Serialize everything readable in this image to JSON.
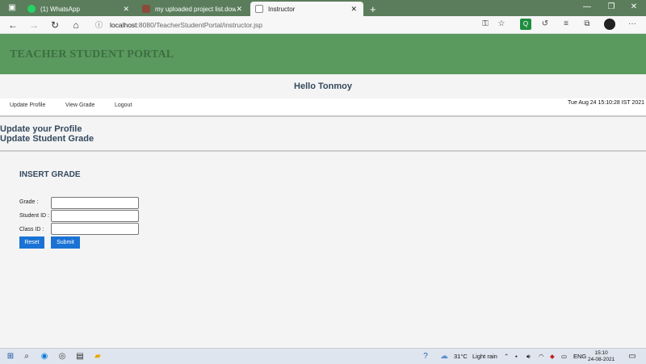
{
  "browser": {
    "tabs": [
      {
        "label": "(1) WhatsApp"
      },
      {
        "label": "my uploaded project list.downlo"
      },
      {
        "label": "Instructor"
      }
    ],
    "new_tab_glyph": "+",
    "close_glyph": "✕",
    "window_controls": {
      "minimize": "—",
      "restore": "❐",
      "close": "✕"
    },
    "url_host": "localhost",
    "url_rest": ":8080/TeacherStudentPortal/instructor.jsp",
    "nav": {
      "back": "←",
      "forward": "→",
      "reload": "↻",
      "home": "⌂"
    },
    "more_glyph": "···"
  },
  "page": {
    "banner_title": "TEACHER STUDENT PORTAL",
    "greeting": "Hello Tonmoy",
    "menu": {
      "update_profile": "Update Profile",
      "view_grade": "View Grade",
      "logout": "Logout"
    },
    "datetime": "Tue Aug 24 15:10:28 IST 2021",
    "links": {
      "update_profile": "Update your Profile",
      "update_grade": "Update Student Grade"
    },
    "form": {
      "heading": "INSERT GRADE",
      "grade_label": "Grade :",
      "student_id_label": "Student ID :",
      "class_id_label": "Class ID :",
      "grade_value": "",
      "student_id_value": "",
      "class_id_value": "",
      "reset_label": "Reset",
      "submit_label": "Submit"
    }
  },
  "taskbar": {
    "weather_temp": "31°C",
    "weather_text": "Light rain",
    "language": "ENG",
    "time": "15:10",
    "date": "24-08-2021"
  },
  "colors": {
    "tabbar": "#5b7d5c",
    "banner": "#5a9a5e",
    "banner_text": "#3d6e41",
    "heading_text": "#34495e",
    "button": "#1a73d4"
  }
}
